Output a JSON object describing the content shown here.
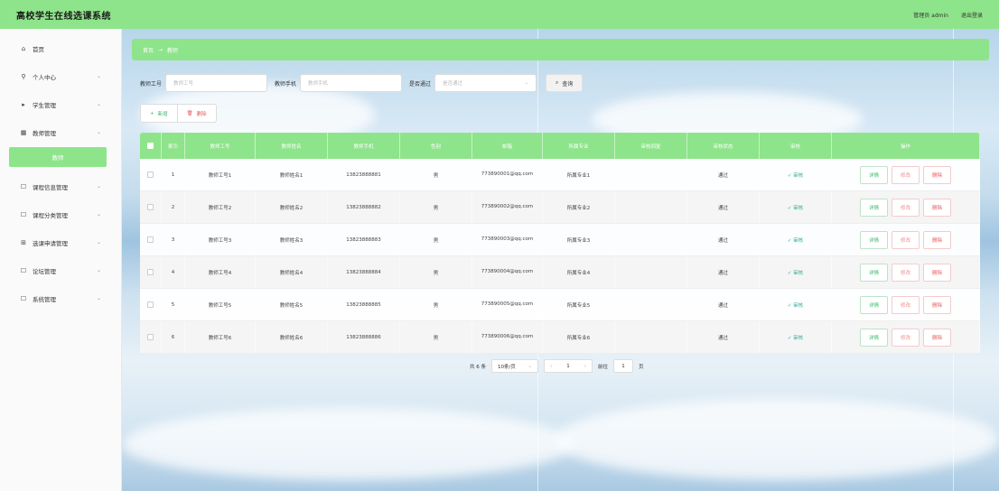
{
  "app": {
    "title": "高校学生在线选课系统",
    "user_text": "管理员 admin",
    "logout": "退出登录"
  },
  "sidebar": {
    "items": [
      {
        "label": "首页",
        "icon": "home-icon",
        "glyph": "⌂",
        "chev": ""
      },
      {
        "label": "个人中心",
        "icon": "user-icon",
        "glyph": "⚲",
        "chev": "⌄"
      },
      {
        "label": "学生管理",
        "icon": "student-icon",
        "glyph": "▸",
        "chev": "⌄"
      },
      {
        "label": "教师管理",
        "icon": "teacher-icon",
        "glyph": "▦",
        "chev": "⌄"
      },
      {
        "label": "课程信息管理",
        "icon": "course-icon",
        "glyph": "☐",
        "chev": "⌄"
      },
      {
        "label": "课程分类管理",
        "icon": "category-icon",
        "glyph": "☐",
        "chev": "⌄"
      },
      {
        "label": "选课申请管理",
        "icon": "apply-icon",
        "glyph": "⊞",
        "chev": "⌄"
      },
      {
        "label": "论坛管理",
        "icon": "forum-icon",
        "glyph": "☐",
        "chev": "⌄"
      },
      {
        "label": "系统管理",
        "icon": "system-icon",
        "glyph": "☐",
        "chev": "⌄"
      }
    ],
    "active_sub": "教师"
  },
  "breadcrumb": {
    "home": "首页",
    "sep": "→",
    "current": "教师"
  },
  "search": {
    "f1_label": "教师工号",
    "f1_placeholder": "教师工号",
    "f2_label": "教师手机",
    "f2_placeholder": "教师手机",
    "f3_label": "是否通过",
    "f3_placeholder": "是否通过",
    "button": "查询"
  },
  "actions": {
    "add": "新增",
    "delete": "删除"
  },
  "table": {
    "headers": [
      "",
      "索引",
      "教师工号",
      "教师姓名",
      "教师手机",
      "性别",
      "邮箱",
      "所属专业",
      "审核回复",
      "审核状态",
      "审核",
      "操作"
    ],
    "review_text": "审核",
    "op_detail": "详情",
    "op_edit": "修改",
    "op_delete": "删除",
    "rows": [
      {
        "idx": "1",
        "no": "教师工号1",
        "name": "教师姓名1",
        "phone": "13823888881",
        "sex": "男",
        "email": "773890001@qq.com",
        "major": "所属专业1",
        "reply": "",
        "status": "通过"
      },
      {
        "idx": "2",
        "no": "教师工号2",
        "name": "教师姓名2",
        "phone": "13823888882",
        "sex": "男",
        "email": "773890002@qq.com",
        "major": "所属专业2",
        "reply": "",
        "status": "通过"
      },
      {
        "idx": "3",
        "no": "教师工号3",
        "name": "教师姓名3",
        "phone": "13823888883",
        "sex": "男",
        "email": "773890003@qq.com",
        "major": "所属专业3",
        "reply": "",
        "status": "通过"
      },
      {
        "idx": "4",
        "no": "教师工号4",
        "name": "教师姓名4",
        "phone": "13823888884",
        "sex": "男",
        "email": "773890004@qq.com",
        "major": "所属专业4",
        "reply": "",
        "status": "通过"
      },
      {
        "idx": "5",
        "no": "教师工号5",
        "name": "教师姓名5",
        "phone": "13823888885",
        "sex": "男",
        "email": "773890005@qq.com",
        "major": "所属专业5",
        "reply": "",
        "status": "通过"
      },
      {
        "idx": "6",
        "no": "教师工号6",
        "name": "教师姓名6",
        "phone": "13823888886",
        "sex": "男",
        "email": "773890006@qq.com",
        "major": "所属专业6",
        "reply": "",
        "status": "通过"
      }
    ]
  },
  "pager": {
    "total": "共 6 条",
    "page_size": "10条/页",
    "prev": "‹",
    "page": "1",
    "next": "›",
    "goto_label": "前往",
    "goto_value": "1",
    "goto_suffix": "页"
  },
  "colors": {
    "accent": "#8ee48a",
    "danger": "#e85a5a",
    "success": "#3bb76a"
  }
}
